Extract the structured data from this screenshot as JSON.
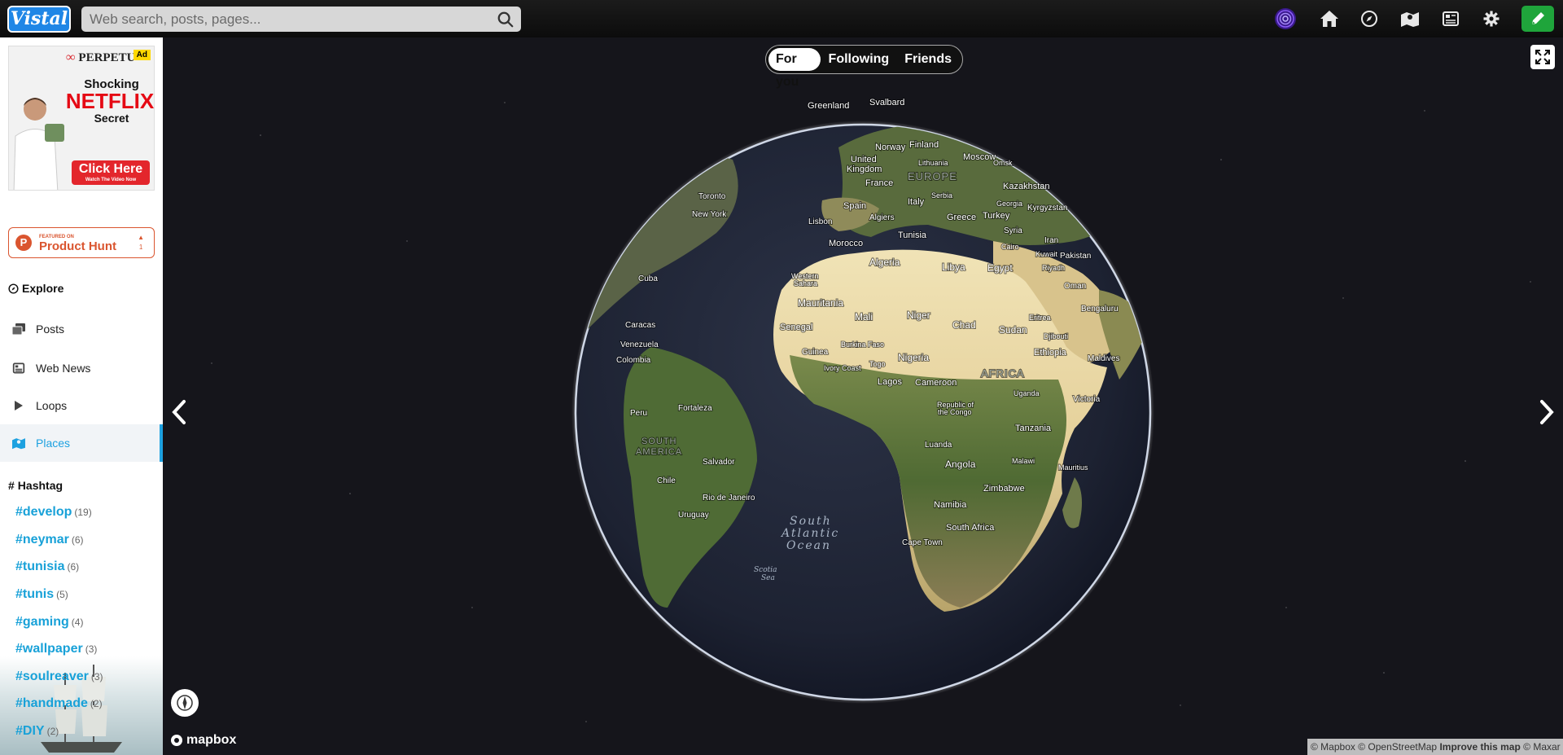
{
  "app": {
    "logo_text": "Vistal"
  },
  "search": {
    "placeholder": "Web search, posts, pages..."
  },
  "header_icons": [
    "spiral-avatar-icon",
    "home-icon",
    "compass-icon",
    "map-icon",
    "news-icon",
    "gear-icon",
    "pencil-icon"
  ],
  "colors": {
    "accent": "#1da1e0",
    "logo_blue": "#1f86e6",
    "compose_green": "#1fa53b",
    "product_hunt": "#da552f"
  },
  "ad": {
    "brand": "PERPETU",
    "tag": "Ad",
    "line1": "Shocking",
    "line2": "NETFLIX",
    "line3": "Secret",
    "cta": "Click Here",
    "cta_sub": "Watch The Video Now"
  },
  "product_hunt": {
    "small": "FEATURED ON",
    "name": "Product Hunt",
    "count": "1"
  },
  "sidebar": {
    "explore_title": "Explore",
    "items": [
      {
        "label": "Posts",
        "icon": "posts-icon",
        "active": false
      },
      {
        "label": "Web News",
        "icon": "news-icon",
        "active": false
      },
      {
        "label": "Loops",
        "icon": "play-icon",
        "active": false
      },
      {
        "label": "Places",
        "icon": "map-icon",
        "active": true
      }
    ],
    "hashtag_title": "Hashtag",
    "hashtags": [
      {
        "tag": "#develop",
        "count": "(19)"
      },
      {
        "tag": "#neymar",
        "count": "(6)"
      },
      {
        "tag": "#tunisia",
        "count": "(6)"
      },
      {
        "tag": "#tunis",
        "count": "(5)"
      },
      {
        "tag": "#gaming",
        "count": "(4)"
      },
      {
        "tag": "#wallpaper",
        "count": "(3)"
      },
      {
        "tag": "#soulreaver",
        "count": "(3)"
      },
      {
        "tag": "#handmade",
        "count": "(2)"
      },
      {
        "tag": "#DIY",
        "count": "(2)"
      }
    ]
  },
  "feed_tabs": [
    {
      "label": "For you",
      "active": true
    },
    {
      "label": "Following",
      "active": false
    },
    {
      "label": "Friends",
      "active": false
    }
  ],
  "map": {
    "brand": "mapbox",
    "attribution": {
      "a": "© Mapbox",
      "b": "© OpenStreetMap",
      "improve": "Improve this map",
      "c": "© Maxar"
    },
    "labels": {
      "greenland": "Greenland",
      "svalbard": "Svalbard",
      "norway": "Norway",
      "finland": "Finland",
      "united_kingdom_1": "United",
      "united_kingdom_2": "Kingdom",
      "lithuania": "Lithuania",
      "moscow": "Moscow",
      "omsk": "Omsk",
      "france": "France",
      "europe": "EUROPE",
      "kazakhstan": "Kazakhstan",
      "toronto": "Toronto",
      "serbia": "Serbia",
      "spain": "Spain",
      "italy": "Italy",
      "georgia": "Georgia",
      "kyrgyzstan": "Kyrgyzstan",
      "new_york": "New York",
      "lisbon": "Lisbon",
      "algiers": "Algiers",
      "greece": "Greece",
      "turkey": "Turkey",
      "syria": "Syria",
      "tunisia": "Tunisia",
      "iran": "Iran",
      "morocco": "Morocco",
      "cairo": "Cairo",
      "kuwait": "Kuwait",
      "pakistan": "Pakistan",
      "algeria": "Algeria",
      "libya": "Libya",
      "egypt": "Egypt",
      "riyadh": "Riyadh",
      "cuba": "Cuba",
      "western_sahara_1": "Western",
      "western_sahara_2": "Sahara",
      "oman": "Oman",
      "mauritania": "Mauritania",
      "bengaluru": "Bengaluru",
      "mali": "Mali",
      "niger": "Niger",
      "eritrea": "Eritrea",
      "caracas": "Caracas",
      "senegal": "Senegal",
      "chad": "Chad",
      "sudan": "Sudan",
      "djibouti": "Djibouti",
      "venezuela": "Venezuela",
      "burkina_faso": "Burkina Faso",
      "guinea": "Guinea",
      "ethiopia": "Ethiopia",
      "colombia": "Colombia",
      "nigeria": "Nigeria",
      "maldives": "Maldives",
      "ivory_coast": "Ivory Coast",
      "togo": "Togo",
      "africa": "AFRICA",
      "lagos": "Lagos",
      "cameroon": "Cameroon",
      "uganda": "Uganda",
      "victoria": "Victoria",
      "peru": "Peru",
      "fortaleza": "Fortaleza",
      "congo_1": "Republic of",
      "congo_2": "the Congo",
      "tanzania": "Tanzania",
      "south_america_1": "SOUTH",
      "south_america_2": "AMERICA",
      "luanda": "Luanda",
      "salvador": "Salvador",
      "malawi": "Malawi",
      "mauritius": "Mauritius",
      "angola": "Angola",
      "chile": "Chile",
      "zimbabwe": "Zimbabwe",
      "rio": "Rio de Janeiro",
      "namibia": "Namibia",
      "uruguay": "Uruguay",
      "south_africa": "South Africa",
      "ocean_1": "South",
      "ocean_2": "Atlantic",
      "ocean_3": "Ocean",
      "cape_town": "Cape Town",
      "scotia_1": "Scotia",
      "scotia_2": "Sea"
    }
  }
}
